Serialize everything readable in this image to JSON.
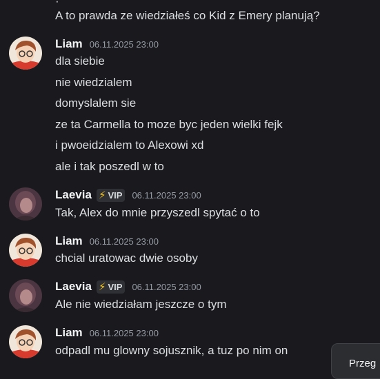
{
  "messages": [
    {
      "text": "A to prawda ze wiedziałeś co Kid z Emery planują?"
    },
    {
      "author": "Liam",
      "time": "06.11.2025 23:00",
      "lines": [
        "dla siebie",
        "nie wiedzialem",
        "domyslalem sie",
        "ze ta Carmella to moze byc jeden wielki fejk",
        "i pwoeidzialem to Alexowi xd",
        "ale i tak poszedl w to"
      ]
    },
    {
      "author": "Laevia",
      "badge": "VIP",
      "time": "06.11.2025 23:00",
      "lines": [
        "Tak, Alex do mnie przyszedl spytać o to"
      ]
    },
    {
      "author": "Liam",
      "time": "06.11.2025 23:00",
      "lines": [
        "chcial uratowac dwie osoby"
      ]
    },
    {
      "author": "Laevia",
      "badge": "VIP",
      "time": "06.11.2025 23:00",
      "lines": [
        "Ale nie wiedziałam jeszcze o tym"
      ]
    },
    {
      "author": "Liam",
      "time": "06.11.2025 23:00",
      "lines": [
        "odpadl mu glowny sojusznik, a tuz po nim on"
      ]
    }
  ],
  "popup": {
    "label": "Przeg"
  },
  "colors": {
    "background": "#1a1a1e",
    "timestamp": "#949ba4",
    "vip_bolt": "#f5c518"
  },
  "icons": {
    "badge": "lightning-bolt-icon"
  }
}
